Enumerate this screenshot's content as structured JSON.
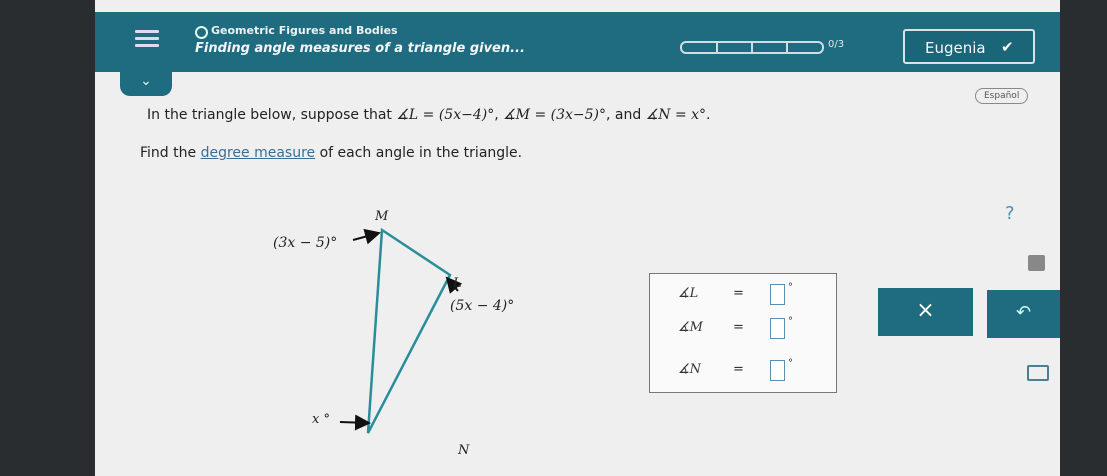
{
  "header": {
    "topic": "Geometric Figures and Bodies",
    "subtitle": "Finding angle measures of a triangle given...",
    "progress_text": "0/3",
    "progress_value": 0,
    "user": "Eugenia",
    "icons": [
      "menu-icon",
      "chevron-down-icon",
      "check-icon"
    ],
    "accent_color": "#1f6c80"
  },
  "language_button": "Español",
  "problem": {
    "prefix": "In the triangle below, suppose that",
    "angle_l": "∡L = (5x−4)°",
    "sep1": ",",
    "angle_m": "∡M = (3x−5)°",
    "sep2": ", and",
    "angle_n": "∡N = x°",
    "end": ".",
    "find_prefix": "Find the",
    "find_link": "degree measure",
    "find_suffix": "of each angle in the triangle."
  },
  "figure": {
    "vertex_m": "M",
    "vertex_l": "L",
    "vertex_n": "N",
    "angle_m_label": "(3x − 5)°",
    "angle_l_label": "(5x − 4)°",
    "angle_n_label": "x °"
  },
  "answers": [
    {
      "label": "∡L",
      "eq": "=",
      "value": "",
      "unit": "°"
    },
    {
      "label": "∡M",
      "eq": "=",
      "value": "",
      "unit": "°"
    },
    {
      "label": "∡N",
      "eq": "=",
      "value": "",
      "unit": "°"
    }
  ],
  "buttons": {
    "clear": "×",
    "undo": "↶"
  },
  "side_icons": {
    "help": "?",
    "calculator": "calculator-icon",
    "mail": "mail-icon"
  }
}
